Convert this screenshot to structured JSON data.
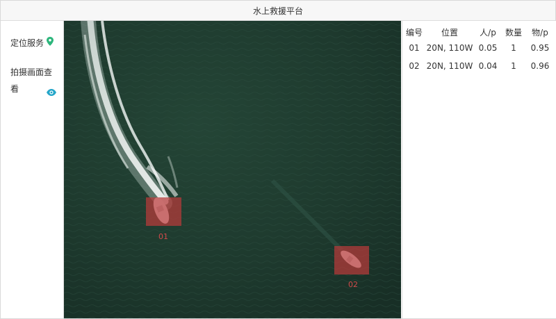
{
  "app": {
    "title": "水上救援平台"
  },
  "sidebar": {
    "items": [
      {
        "label": "定位服务",
        "icon": "location-pin-icon",
        "icon_color": "#2db67c"
      },
      {
        "label": "拍摄画面查看",
        "icon": "eye-icon",
        "icon_color": "#26a6c9"
      }
    ]
  },
  "table": {
    "headers": [
      "编号",
      "位置",
      "人/p",
      "数量",
      "物/p"
    ],
    "rows": [
      {
        "id": "01",
        "position": "20N, 110W",
        "person_p": "0.05",
        "count": "1",
        "object_p": "0.95"
      },
      {
        "id": "02",
        "position": "20N, 110W",
        "person_p": "0.04",
        "count": "1",
        "object_p": "0.96"
      }
    ]
  },
  "detections": [
    {
      "label": "01"
    },
    {
      "label": "02"
    }
  ],
  "colors": {
    "water": "#1f3b30",
    "box_fill": "#b93a3a",
    "box_label": "#d24a4a"
  }
}
